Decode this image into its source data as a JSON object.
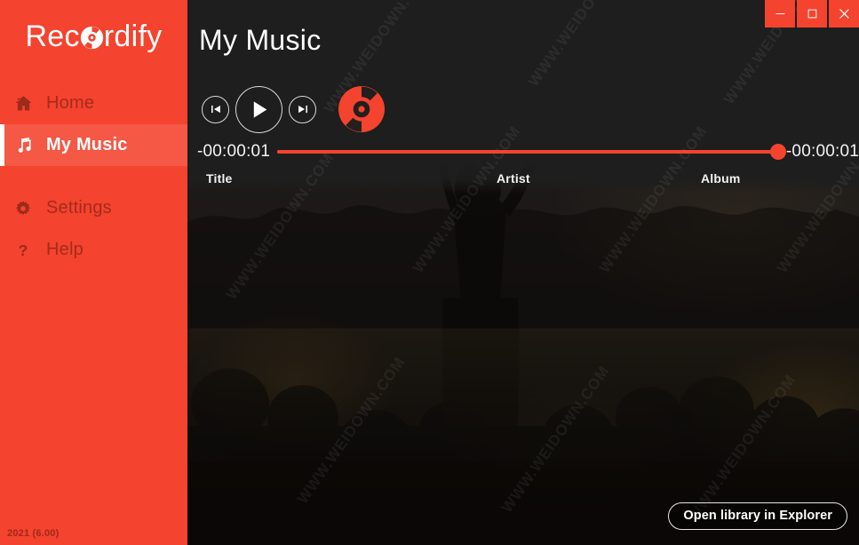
{
  "app": {
    "logo_before": "Rec",
    "logo_after": "rdify",
    "logo_icon": "vinyl-record-icon",
    "version": "2021 (6.00)",
    "accent_color": "#F4432E",
    "accent_light": "#F55845",
    "sidebar_text_color": "#A32C1C",
    "background_color": "#1E1E1E"
  },
  "titlebar": {
    "buttons": [
      {
        "name": "minimize",
        "glyph": "—"
      },
      {
        "name": "maximize",
        "glyph": "□"
      },
      {
        "name": "close",
        "glyph": "✕"
      }
    ]
  },
  "sidebar": {
    "items": [
      {
        "label": "Home",
        "icon": "home-icon",
        "active": false
      },
      {
        "label": "My Music",
        "icon": "music-note-icon",
        "active": true
      },
      {
        "label": "Settings",
        "icon": "gear-icon",
        "active": false
      },
      {
        "label": "Help",
        "icon": "question-mark-icon",
        "active": false
      }
    ]
  },
  "main": {
    "page_title": "My Music",
    "player": {
      "previous_label": "Previous",
      "play_label": "Play",
      "next_label": "Next",
      "record_label": "Record",
      "elapsed_time": "-00:00:01",
      "remaining_time": "-00:00:01",
      "progress_percent": 100
    },
    "columns": [
      {
        "label": "Title"
      },
      {
        "label": "Artist"
      },
      {
        "label": "Album"
      }
    ],
    "tracks": [],
    "open_library_label": "Open library in Explorer"
  },
  "watermark": {
    "text": "WWW.WEIDOWN.COM"
  }
}
